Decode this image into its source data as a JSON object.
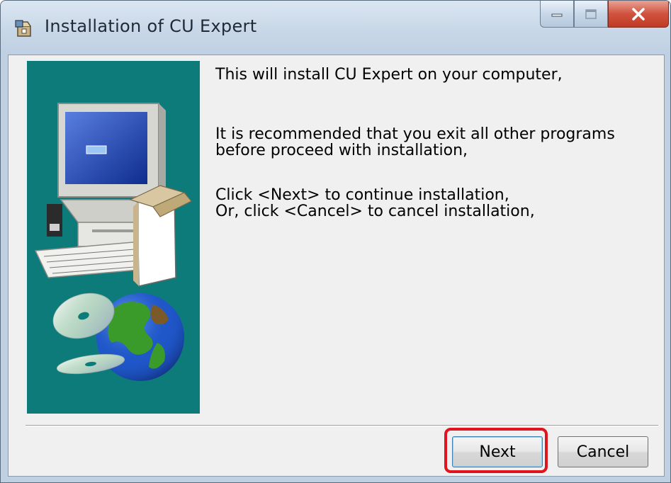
{
  "window": {
    "title": "Installation of CU Expert",
    "app_icon": "installer-icon",
    "controls": {
      "minimize_icon": "minimize-icon",
      "maximize_icon": "maximize-icon",
      "close_icon": "close-icon"
    }
  },
  "banner": {
    "background_color": "#0e7b7b",
    "illustration": [
      "computer-icon",
      "open-box-icon",
      "cd-discs-icon",
      "globe-icon"
    ]
  },
  "body_text": {
    "line1": "This will install CU Expert on your computer,",
    "line2": "It is recommended that you exit all other programs\nbefore proceed with installation,",
    "line3": "Click <Next> to continue installation,\nOr, click <Cancel> to cancel installation,"
  },
  "buttons": {
    "next_label": "Next",
    "cancel_label": "Cancel",
    "highlight_color": "#e0141e"
  }
}
